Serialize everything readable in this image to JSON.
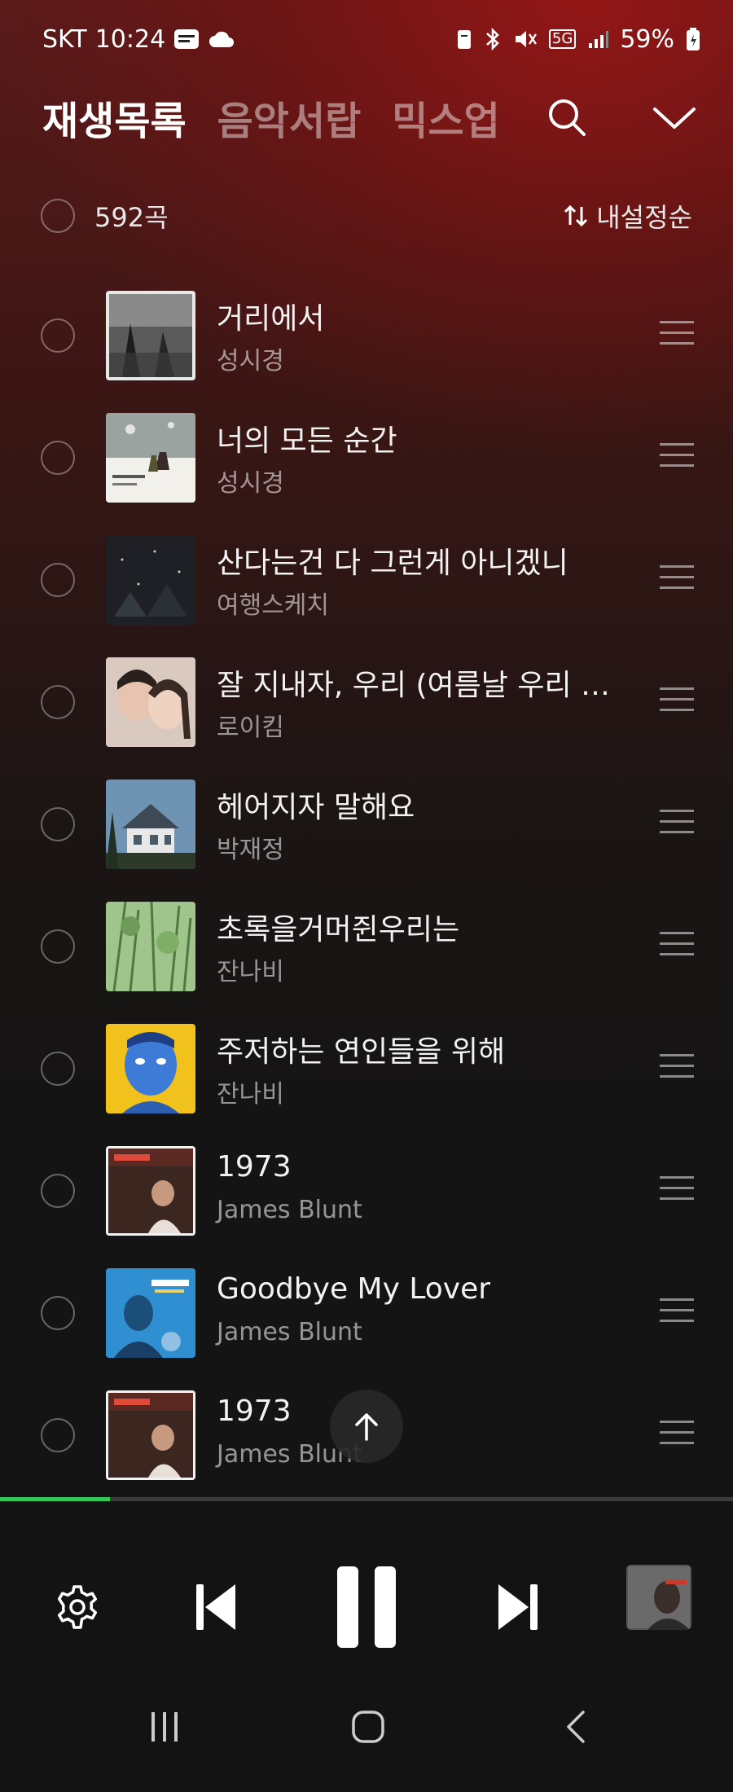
{
  "status_bar": {
    "carrier": "SKT",
    "time": "10:24",
    "network": "5G",
    "battery": "59%"
  },
  "tabs": [
    {
      "label": "재생목록",
      "active": true
    },
    {
      "label": "음악서랍",
      "active": false
    },
    {
      "label": "믹스업",
      "active": false
    }
  ],
  "list_header": {
    "count": "592곡",
    "sort_label": "내설정순"
  },
  "songs": [
    {
      "title": "거리에서",
      "artist": "성시경"
    },
    {
      "title": "너의 모든 순간",
      "artist": "성시경"
    },
    {
      "title": "산다는건 다 그런게 아니겠니",
      "artist": "여행스케치"
    },
    {
      "title": "잘 지내자, 우리 (여름날 우리 X...",
      "artist": "로이킴"
    },
    {
      "title": "헤어지자 말해요",
      "artist": "박재정"
    },
    {
      "title": "초록을거머쥔우리는",
      "artist": "잔나비"
    },
    {
      "title": "주저하는 연인들을 위해",
      "artist": "잔나비"
    },
    {
      "title": "1973",
      "artist": "James Blunt"
    },
    {
      "title": "Goodbye My Lover",
      "artist": "James Blunt"
    },
    {
      "title": "1973",
      "artist": "James Blunt"
    }
  ],
  "player": {
    "progress": 0.15,
    "accent_color": "#34c759"
  },
  "icons": {
    "search": "search-icon",
    "collapse": "chevron-down-icon",
    "sort": "sort-arrows-icon",
    "settings": "gear-icon",
    "previous": "skip-previous-icon",
    "pause": "pause-icon",
    "next": "skip-next-icon",
    "drag": "drag-handle-icon",
    "scroll_top": "arrow-up-icon"
  }
}
